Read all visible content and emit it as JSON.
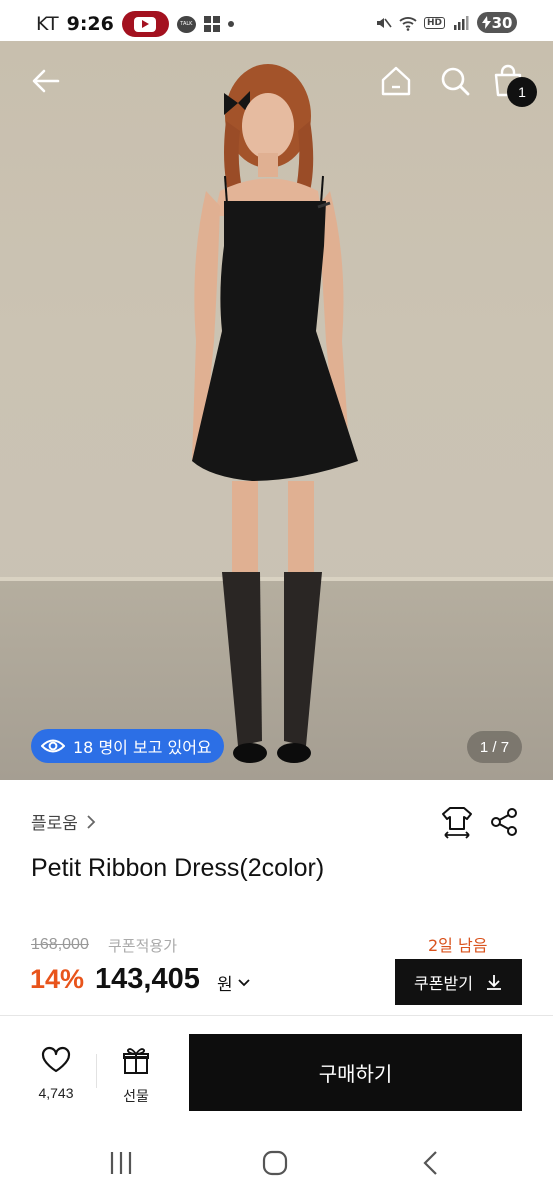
{
  "status_bar": {
    "carrier": "KT",
    "time": "9:26",
    "talk_label": "TALK",
    "hd_label": "HD",
    "battery": "30"
  },
  "hero": {
    "viewers_text": "18 명이 보고 있어요",
    "page_indicator": "1 / 7",
    "cart_count": "1"
  },
  "product": {
    "brand": "플로움",
    "title": "Petit Ribbon Dress(2color)",
    "original_price": "168,000",
    "coupon_applied_label": "쿠폰적용가",
    "days_left": "2일 남음",
    "discount": "14%",
    "sale_price": "143,405",
    "currency": "원",
    "coupon_button_label": "쿠폰받기"
  },
  "action_bar": {
    "like_count": "4,743",
    "gift_label": "선물",
    "buy_label": "구매하기"
  },
  "colors": {
    "accent_blue": "#2c6fe6",
    "discount_orange": "#e8541b",
    "days_left_orange": "#d9531e",
    "button_black": "#0d0d0d"
  },
  "icons": [
    "back-arrow-icon",
    "home-icon",
    "search-icon",
    "cart-icon",
    "eye-icon",
    "chevron-right-icon",
    "size-guide-icon",
    "share-icon",
    "chevron-down-icon",
    "download-icon",
    "heart-icon",
    "gift-icon"
  ]
}
